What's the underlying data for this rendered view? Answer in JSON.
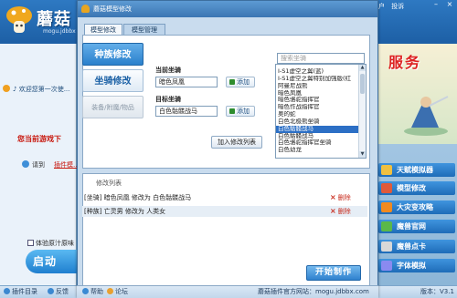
{
  "app": {
    "logo_text": "蘑菇",
    "logo_sub": "mogu.jdbbx",
    "top_links": [
      "户",
      "投诉"
    ],
    "welcome": "1 当前游戏下...",
    "welcome_line": "♪ 欢迎您第一次使...",
    "current_game": "您当前游戏下",
    "please": "请到",
    "plugin_link": "插件模...",
    "check_label": "体验原汁原味",
    "start_label": "启动",
    "status_left": "插件目录",
    "status_feedback": "反馈",
    "status_version": "版本：V3.1",
    "ad_text": "服务",
    "right_menu": [
      {
        "label": "天赋模拟器",
        "color": "#2a7fd0"
      },
      {
        "label": "模型修改",
        "color": "#2a7fd0"
      },
      {
        "label": "大灾变攻略",
        "color": "#2a7fd0"
      },
      {
        "label": "魔兽官网",
        "color": "#2a7fd0"
      },
      {
        "label": "魔兽点卡",
        "color": "#2a7fd0"
      },
      {
        "label": "字体模拟",
        "color": "#2a7fd0"
      }
    ]
  },
  "dialog": {
    "title": "蘑菇模型修改",
    "tabs": [
      {
        "label": "模型修改",
        "active": true
      },
      {
        "label": "模型管理",
        "active": false
      }
    ],
    "side_buttons": [
      {
        "label": "种族修改",
        "state": "on"
      },
      {
        "label": "坐骑修改",
        "state": "off"
      },
      {
        "label": "装备/附魔/物品",
        "state": "dim"
      }
    ],
    "current_mount_label": "当前坐骑",
    "current_mount_value": "暗色凤凰",
    "target_mount_label": "目标坐骑",
    "target_mount_value": "白色骷髅战马",
    "add_label": "添加",
    "add_to_list_label": "加入修改列表",
    "search_placeholder": "搜索坐骑",
    "mount_list": [
      "I-S1虚空之翼(蓝)",
      "I-S1虚空之翼特别加强版(红",
      "阿曼尼战熊",
      "暗色凤凰",
      "暗色骆驼指挥官",
      "暗色作战指挥官",
      "奥的蛇",
      "白色北极熊坐骑",
      "白色骷髅战马",
      "白色骷髅战马",
      "白色骆驼指挥官坐骑",
      "白色幼龙"
    ],
    "selected_index": 8,
    "mod_list_title": "修改列表",
    "mod_rows": [
      {
        "text": "[坐骑] 暗色凤凰 修改为 白色骷髅战马",
        "delete": "删除"
      },
      {
        "text": "[种族] 亡灵男 修改为 人类女",
        "delete": "删除"
      }
    ],
    "start_button": "开始制作",
    "footer_help": "帮助",
    "footer_forum": "论坛",
    "footer_site": "蘑菇插件官方网站：mogu.jdbbx.com"
  }
}
